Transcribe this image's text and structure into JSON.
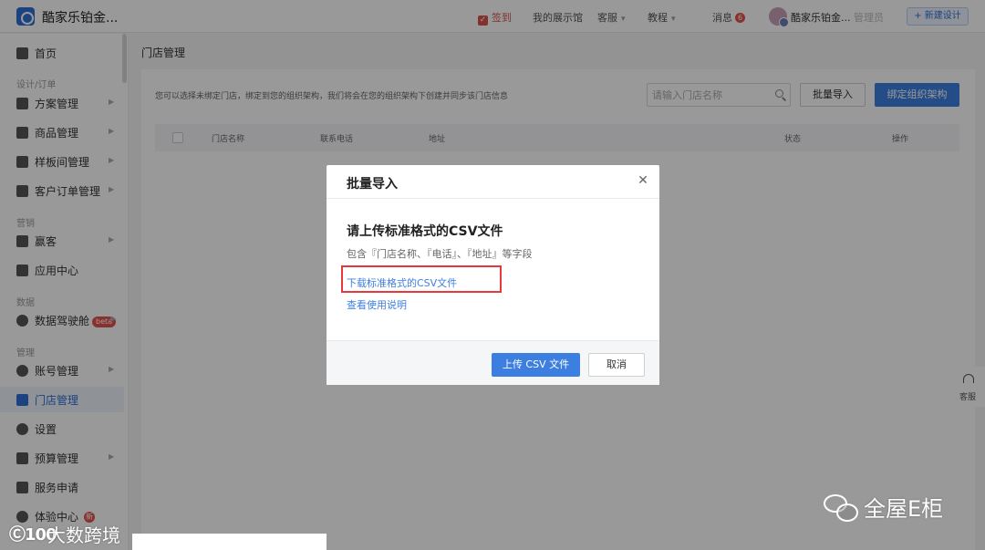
{
  "header": {
    "app_title": "酷家乐铂金...",
    "sign_in": "签到",
    "showroom": "我的展示馆",
    "customer_service": "客服",
    "tutorial": "教程",
    "messages": "消息",
    "message_count": "6",
    "user_name": "酷家乐铂金...",
    "role": "管理员",
    "new_design": "+ 新建设计"
  },
  "sidebar": {
    "items": [
      {
        "label": "首页"
      },
      {
        "label": "方案管理"
      },
      {
        "label": "商品管理"
      },
      {
        "label": "样板间管理"
      },
      {
        "label": "客户订单管理"
      },
      {
        "label": "赢客"
      },
      {
        "label": "应用中心"
      },
      {
        "label": "数据驾驶舱",
        "badge": "beta"
      },
      {
        "label": "账号管理"
      },
      {
        "label": "门店管理"
      },
      {
        "label": "设置"
      },
      {
        "label": "预算管理"
      },
      {
        "label": "服务申请"
      },
      {
        "label": "体验中心",
        "badge": "新"
      }
    ],
    "sections": [
      "设计/订单",
      "营销",
      "数据",
      "管理"
    ]
  },
  "main": {
    "page_title": "门店管理",
    "description": "您可以选择未绑定门店，绑定到您的组织架构，我们将会在您的组织架构下创建并同步该门店信息",
    "search_placeholder": "请输入门店名称",
    "import_button": "批量导入",
    "bind_button": "绑定组织架构",
    "table": {
      "columns": [
        "门店名称",
        "联系电话",
        "地址",
        "状态",
        "操作"
      ]
    }
  },
  "modal": {
    "title": "批量导入",
    "heading": "请上传标准格式的CSV文件",
    "subtext": "包含『门店名称、『电话』、『地址』等字段",
    "download_link": "下载标准格式的CSV文件",
    "help_link": "查看使用说明",
    "upload_button": "上传 CSV 文件",
    "cancel_button": "取消"
  },
  "service_float": {
    "label": "客服"
  },
  "watermarks": {
    "right": "全屋E柜",
    "left_logo": "Ⓒ100",
    "left": "大数跨境"
  },
  "colors": {
    "accent": "#3d7fe0",
    "highlight": "#e5393c",
    "badge": "#e5534b"
  }
}
